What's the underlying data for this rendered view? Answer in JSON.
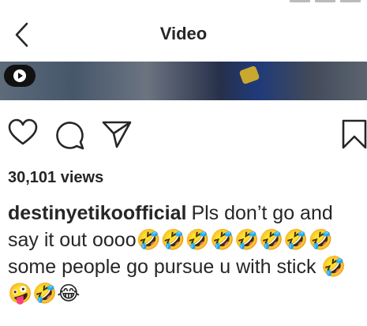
{
  "header": {
    "title": "Video"
  },
  "post": {
    "views": "30,101 views",
    "username": "destinyetikoofficial",
    "caption": "Pls don’t go and say it out oooo🤣🤣🤣🤣🤣🤣🤣🤣 some people go pursue u with stick 🤣 🤪🤣😂"
  },
  "icons": {
    "back": "chevron-left-icon",
    "like": "heart-outline-icon",
    "comment": "comment-bubble-icon",
    "share": "paper-plane-icon",
    "save": "bookmark-icon",
    "play": "play-icon"
  }
}
